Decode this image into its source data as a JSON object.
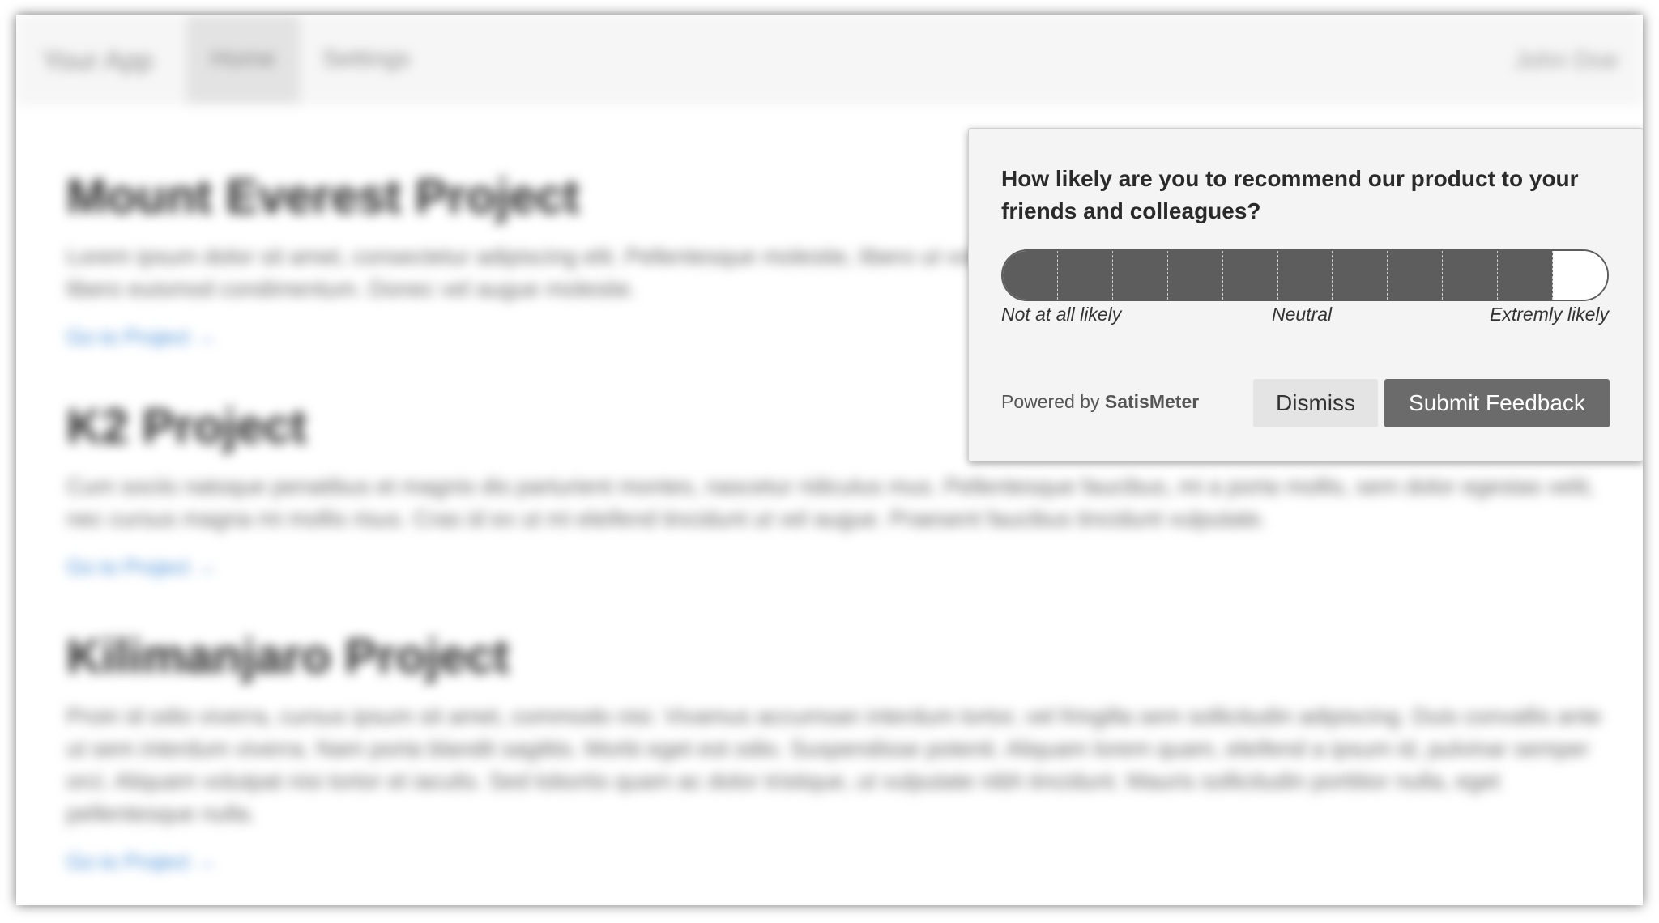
{
  "app": {
    "navbar": {
      "brand": "Your App",
      "items": [
        {
          "label": "Home",
          "active": true
        },
        {
          "label": "Settings",
          "active": false
        }
      ],
      "user": "John Doe"
    },
    "projects": [
      {
        "title": "Mount Everest Project",
        "text": "Lorem ipsum dolor sit amet, consectetur adipiscing elit. Pellentesque molestie, libero ut volutpat sodales, diam velit sit amet sapien. Nulla aliquam in libero euismod condimentum. Donec vel augue molestie.",
        "link": "Go to Project →"
      },
      {
        "title": "K2 Project",
        "text": "Cum sociis natoque penatibus et magnis dis parturient montes, nascetur ridiculus mus. Pellentesque faucibus, mi a porta mollis, sem dolor egestas velit, nec cursus magna mi mollis risus. Cras id ex ut mi eleifend tincidunt ut vel augue. Praesent faucibus tincidunt vulputate.",
        "link": "Go to Project →"
      },
      {
        "title": "Kilimanjaro Project",
        "text": "Proin id odio viverra, cursus ipsum sit amet, commodo nisi. Vivamus accumsan interdum tortor, vel fringilla sem sollicitudin adipiscing. Duis convallis ante ut sem interdum viverra. Nam porta blandit sagittis. Morbi eget est odio. Suspendisse potenti. Aliquam lorem quam, eleifend a ipsum id, pulvinar semper orci. Aliquam volutpat nisi tortor et iaculis. Sed lobortis quam ac dolor tristique, ut vulputate nibh tincidunt. Mauris sollicitudin porttitor nulla, eget pellentesque nulla.",
        "link": "Go to Project →"
      }
    ]
  },
  "survey": {
    "question": "How likely are you to recommend our product to your friends and colleagues?",
    "scale": {
      "min": 0,
      "max": 10,
      "selected": 10,
      "labels": {
        "left": "Not at all likely",
        "middle": "Neutral",
        "right": "Extremly likely"
      }
    },
    "powered_prefix": "Powered by",
    "powered_brand": "SatisMeter",
    "dismiss_label": "Dismiss",
    "submit_label": "Submit Feedback",
    "colors": {
      "fill": "#5d5d5d",
      "submit_bg": "#6b6b6b",
      "dismiss_bg": "#e4e4e4",
      "panel_bg": "#f4f4f4",
      "link": "#4a8fd8"
    }
  }
}
